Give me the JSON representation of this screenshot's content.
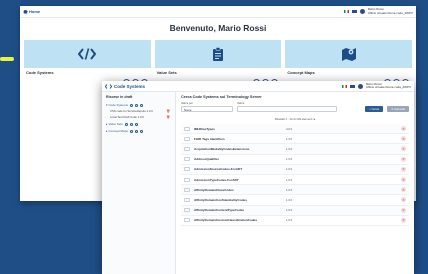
{
  "background": {
    "color": "#1f4e87",
    "accent": "#e7f542"
  },
  "back_window": {
    "home_label": "Home",
    "user_name": "Mario Rossi",
    "user_org": "Ufficio virtuale Roma coda_2WPV",
    "welcome": "Benvenuto, Mario Rossi",
    "cards": [
      {
        "title": "Code Systems",
        "icon": "code-icon"
      },
      {
        "title": "Value Sets",
        "icon": "clipboard-icon"
      },
      {
        "title": "Concept Maps",
        "icon": "map-icon"
      }
    ],
    "card_actions": [
      "search-icon",
      "user-icon",
      "add-icon"
    ]
  },
  "front_window": {
    "brand": "Code Systems",
    "user_name": "Mario Rossi",
    "user_org": "Ufficio virtuale Roma coda_2WPV",
    "sidebar": {
      "title": "Risorse in draft",
      "groups": [
        {
          "label": "Code Systems",
          "items": [
            "CSS code for Servicedispute 1.0.0",
            "Local Test Draft Code 1.0.0"
          ]
        },
        {
          "label": "Value Sets",
          "items": []
        },
        {
          "label": "Concept Maps",
          "items": []
        }
      ]
    },
    "main": {
      "title": "Cerca Code Systems sul Terminology Server",
      "field_type_label": "Valore per",
      "field_type_value": "Nome",
      "field_value_label": "Valore",
      "field_value_value": "",
      "search_button": "Cerca",
      "clear_button": "Cancella",
      "paging": "Risultati 1 - 10 di 139 elementi"
    },
    "rows": [
      {
        "name": "IMHDiseTypes",
        "version": "4.0.0"
      },
      {
        "name": "FHIR Tags Identifiers",
        "version": "1.0.0"
      },
      {
        "name": "AcquisitionModalityCodesExtensions",
        "version": "1.0.0"
      },
      {
        "name": "AddressQualifier",
        "version": "1.0.0"
      },
      {
        "name": "AdmissionSourceCodes-ForADT",
        "version": "1.0.0"
      },
      {
        "name": "AdmissionTypeCodes-ForADT",
        "version": "1.0.0"
      },
      {
        "name": "AffinityDomainClassCodes",
        "version": "1.0.0"
      },
      {
        "name": "AffinityDomainConfidentialityCodes",
        "version": "1.0.0"
      },
      {
        "name": "AffinityDomainContentTypeCodes",
        "version": "1.0.0"
      },
      {
        "name": "AffinityDomainCustomClassificationCodes",
        "version": "1.0.0"
      }
    ]
  }
}
